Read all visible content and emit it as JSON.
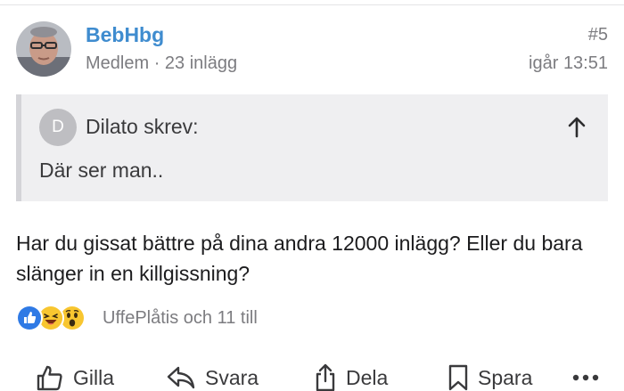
{
  "post": {
    "author": "BebHbg",
    "author_meta": "Medlem · 23 inlägg",
    "number": "#5",
    "time": "igår 13:51",
    "quote": {
      "avatar_letter": "D",
      "author_line": "Dilato skrev:",
      "text": "Där ser man.."
    },
    "body": "Har du gissat bättre på dina andra 12000 inlägg? Eller du bara slänger in en killgissning?",
    "reactions": {
      "icons": [
        "like-reaction-icon",
        "laugh-reaction-icon",
        "wow-reaction-icon"
      ],
      "text": "UffePlåtis och 11 till"
    }
  },
  "actions": {
    "like": "Gilla",
    "reply": "Svara",
    "share": "Dela",
    "save": "Spara"
  },
  "colors": {
    "author_link": "#3f8ccf",
    "quote_background": "#efeff1",
    "like_blue": "#2f7ae5",
    "emoji_yellow": "#f8c630"
  }
}
